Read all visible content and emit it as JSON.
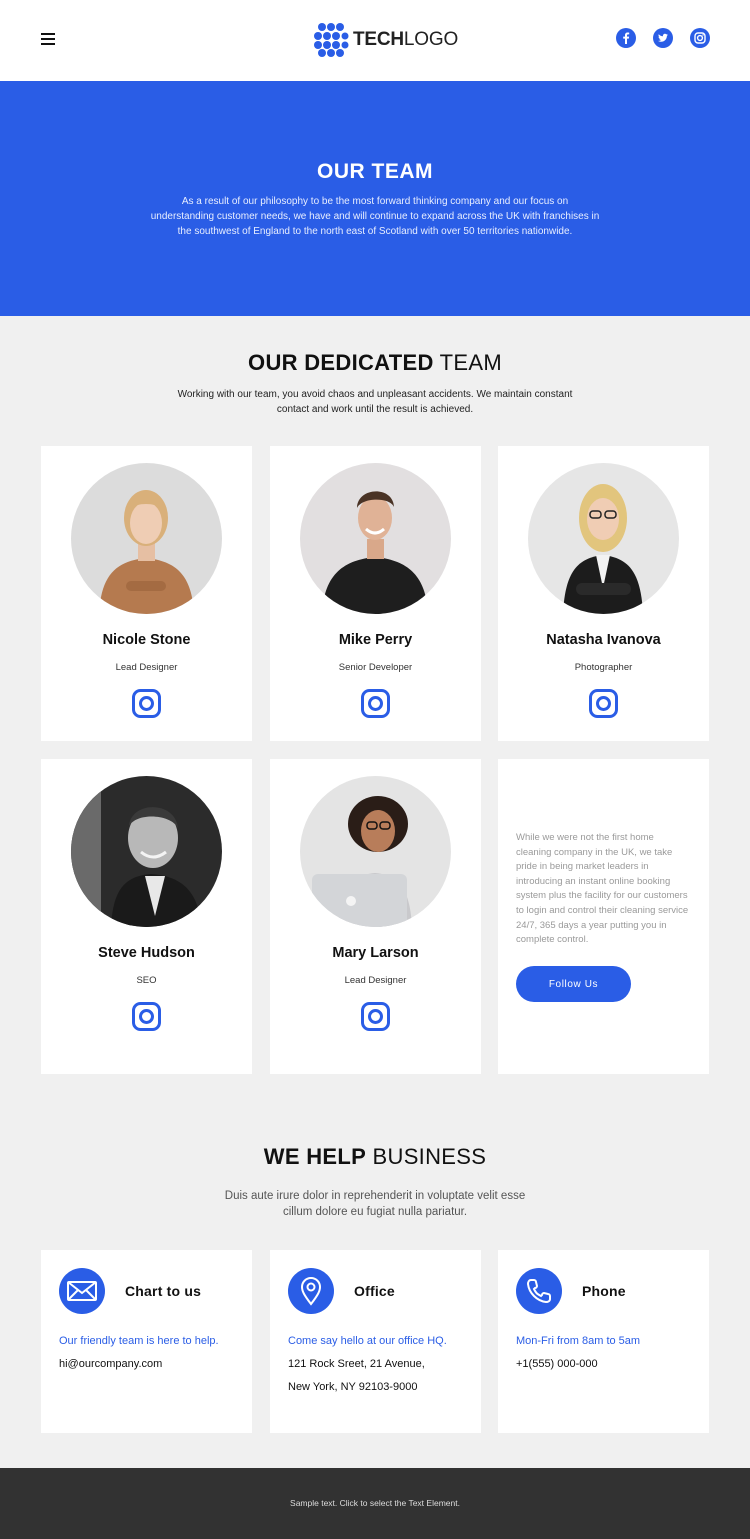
{
  "header": {
    "logo": {
      "bold": "TECH",
      "light": "LOGO"
    },
    "menu_icon": "hamburger-icon",
    "social": [
      "facebook-icon",
      "twitter-icon",
      "instagram-icon"
    ]
  },
  "hero": {
    "title": "OUR TEAM",
    "text": "As a result of our philosophy to be the most forward thinking company and our focus on understanding customer needs, we have and will continue to expand across the UK with franchises in the southwest of England to the north east of Scotland with over 50 territories nationwide."
  },
  "team": {
    "title_bold": "OUR DEDICATED",
    "title_light": " TEAM",
    "subtitle": "Working with our team, you avoid chaos and unpleasant accidents. We maintain constant contact and work until the result is achieved.",
    "members": [
      {
        "name": "Nicole Stone",
        "role": "Lead Designer"
      },
      {
        "name": "Mike Perry",
        "role": "Senior Developer"
      },
      {
        "name": "Natasha Ivanova",
        "role": "Photographer"
      },
      {
        "name": "Steve Hudson",
        "role": "SEO"
      },
      {
        "name": "Mary Larson",
        "role": "Lead Designer"
      }
    ],
    "info_text": "While we were not the first home cleaning company in the UK, we take pride in being market leaders in introducing an instant online booking system plus the facility for our customers to login and control their cleaning service 24/7, 365 days a year putting you in complete control.",
    "follow_label": "Follow Us"
  },
  "help": {
    "title_bold": "WE HELP",
    "title_light": " BUSINESS",
    "subtitle": "Duis aute irure dolor in reprehenderit in voluptate velit esse cillum dolore eu fugiat nulla pariatur.",
    "cards": [
      {
        "title": "Chart to us",
        "lead": "Our friendly team is here to help.",
        "lines": [
          "hi@ourcompany.com"
        ],
        "icon": "mail-icon"
      },
      {
        "title": "Office",
        "lead": "Come say hello at our office HQ.",
        "lines": [
          "121 Rock Sreet, 21 Avenue,",
          "New York, NY 92103-9000"
        ],
        "icon": "location-pin-icon"
      },
      {
        "title": "Phone",
        "lead": "Mon-Fri from 8am to 5am",
        "lines": [
          "+1(555) 000-000"
        ],
        "icon": "phone-icon"
      }
    ]
  },
  "footer": {
    "text": "Sample text. Click to select the Text Element."
  },
  "colors": {
    "accent": "#2a5de6",
    "footer_bg": "#323232",
    "page_bg": "#f0f0f0"
  }
}
